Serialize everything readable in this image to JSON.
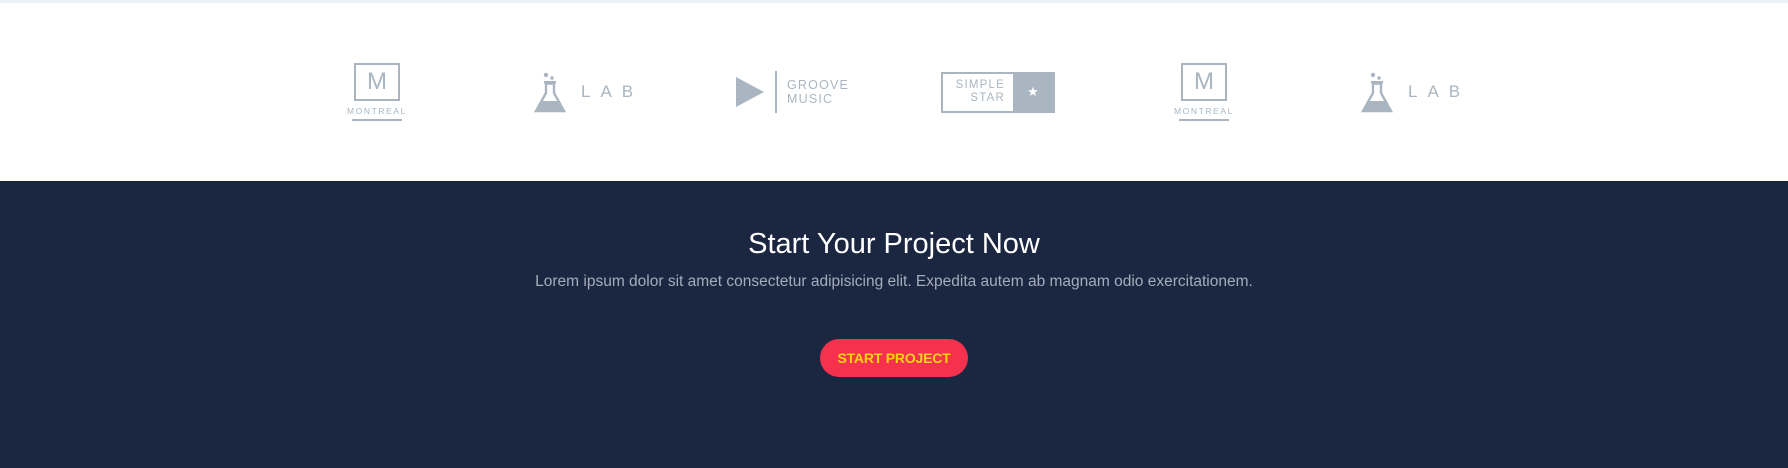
{
  "logos": {
    "montreal_1": {
      "letter": "M",
      "label": "MONTREAL",
      "icon": "montreal-logo"
    },
    "lab_1": {
      "label": "LAB",
      "icon": "flask-icon"
    },
    "groove": {
      "line1": "GROOVE",
      "line2": "MUSIC",
      "icon": "play-triangle-icon"
    },
    "simple_star": {
      "line1": "SIMPLE",
      "line2": "STAR",
      "star": "★",
      "icon": "star-icon"
    },
    "montreal_2": {
      "letter": "M",
      "label": "MONTREAL",
      "icon": "montreal-logo"
    },
    "lab_2": {
      "label": "LAB",
      "icon": "flask-icon"
    },
    "color": "#a9b6c1"
  },
  "cta": {
    "title": "Start Your Project Now",
    "subtitle": "Lorem ipsum dolor sit amet consectetur adipisicing elit. Expedita autem ab magnam odio exercitationem.",
    "button_label": "START PROJECT",
    "background": "#1b2740",
    "button_color": "#f5314e",
    "button_text_color": "#f7d312"
  }
}
